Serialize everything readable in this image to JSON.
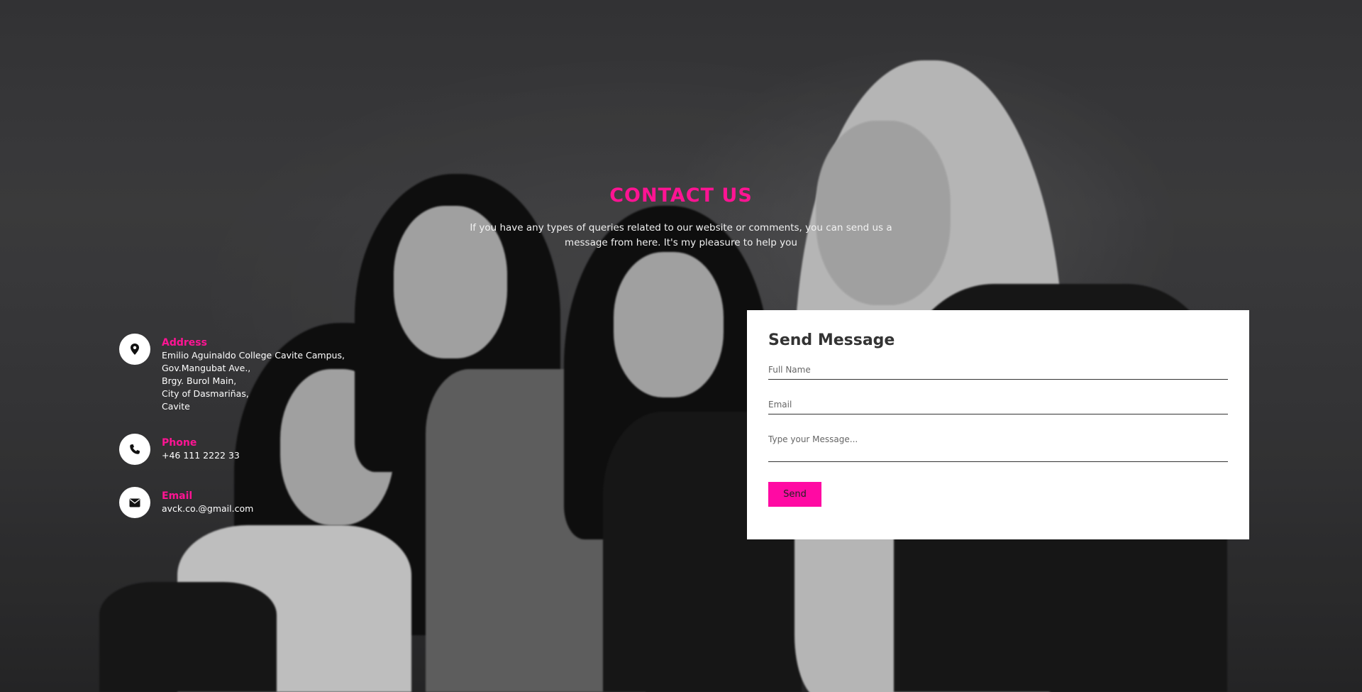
{
  "header": {
    "title": "CONTACT US",
    "subtitle": "If you have any types of queries related to our website or comments, you can send us a message from here. It's my pleasure to help you"
  },
  "contact_info": {
    "address": {
      "label": "Address",
      "icon": "map-pin-icon",
      "lines": [
        "Emilio Aguinaldo College Cavite Campus,",
        "Gov.Mangubat Ave.,",
        "Brgy. Burol Main,",
        "City of Dasmariñas,",
        "Cavite"
      ]
    },
    "phone": {
      "label": "Phone",
      "icon": "phone-icon",
      "value": "+46 111 2222 33"
    },
    "email": {
      "label": "Email",
      "icon": "envelope-icon",
      "value": "avck.co.@gmail.com"
    }
  },
  "form": {
    "title": "Send Message",
    "full_name_placeholder": "Full Name",
    "email_placeholder": "Email",
    "message_placeholder": "Type your Message...",
    "send_label": "Send"
  },
  "colors": {
    "accent": "#ff1493",
    "button": "#ff0aa3",
    "card": "#ffffff"
  }
}
